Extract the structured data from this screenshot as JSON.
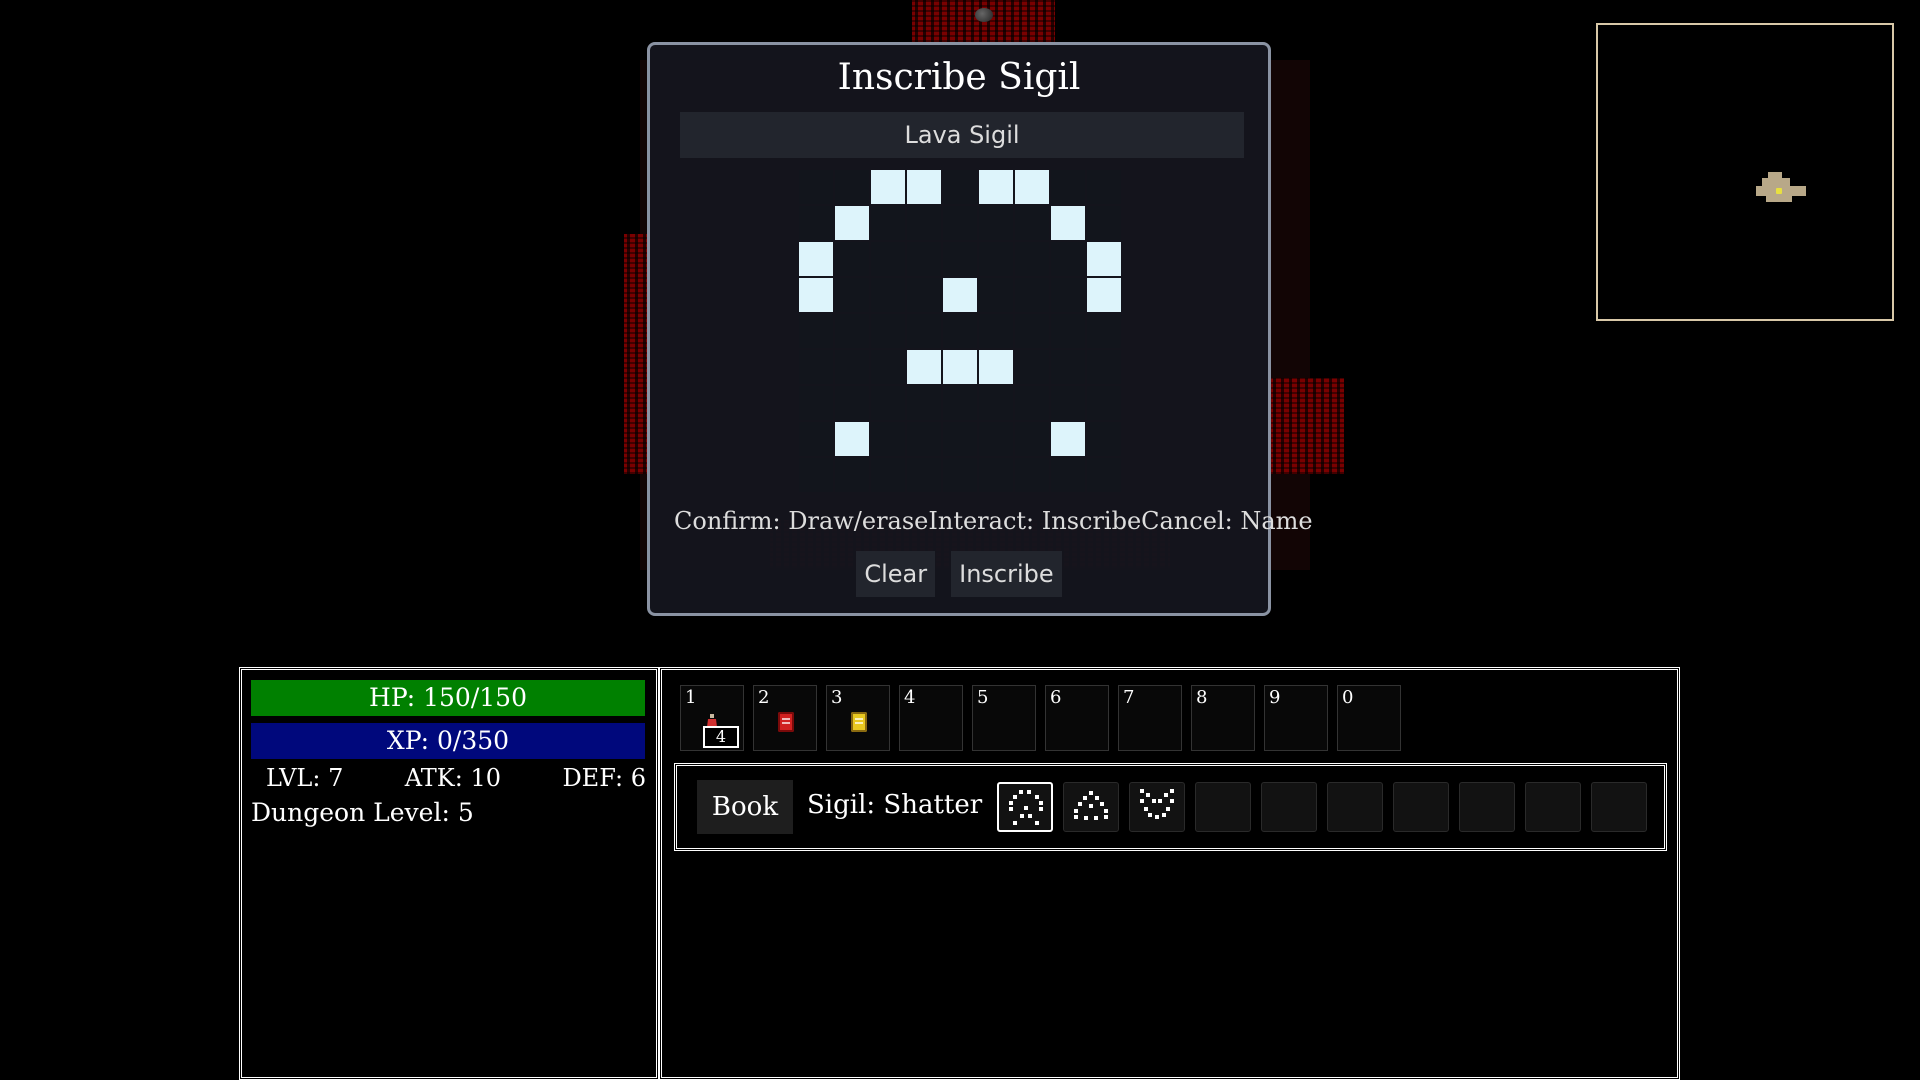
{
  "dialog": {
    "title": "Inscribe Sigil",
    "name_value": "Lava Sigil",
    "grid_pattern": [
      "..##.##..",
      ".#.....#.",
      "#.......#",
      "#...#...#",
      ".........",
      "...###...",
      ".........",
      ".#.....#.",
      "........."
    ],
    "hints": {
      "confirm": "Confirm: Draw/erase",
      "interact": "Interact: Inscribe",
      "cancel": "Cancel: Name"
    },
    "clear_label": "Clear",
    "inscribe_label": "Inscribe"
  },
  "stats": {
    "hp": "HP: 150/150",
    "hp_fraction": 1.0,
    "xp": "XP: 0/350",
    "xp_fraction": 0.0,
    "lvl": "LVL: 7",
    "atk": "ATK: 10",
    "def": "DEF: 6",
    "dungeon_level": "Dungeon Level: 5"
  },
  "hotbar": {
    "slots": [
      {
        "num": "1",
        "icon": "potion-icon",
        "count": "4"
      },
      {
        "num": "2",
        "icon": "red-book-icon"
      },
      {
        "num": "3",
        "icon": "yellow-book-icon"
      },
      {
        "num": "4"
      },
      {
        "num": "5"
      },
      {
        "num": "6"
      },
      {
        "num": "7"
      },
      {
        "num": "8"
      },
      {
        "num": "9"
      },
      {
        "num": "0"
      }
    ]
  },
  "sigils": {
    "book_label": "Book",
    "current_label": "Sigil: Shatter",
    "slots": [
      {
        "icon": "shatter-sigil-icon",
        "selected": true
      },
      {
        "icon": "dome-sigil-icon"
      },
      {
        "icon": "claw-sigil-icon"
      },
      {},
      {},
      {},
      {},
      {},
      {},
      {}
    ]
  },
  "colors": {
    "hp": "#008000",
    "xp": "#00087c",
    "grid_on": "#ddf4fb",
    "lava": "#c01010"
  }
}
